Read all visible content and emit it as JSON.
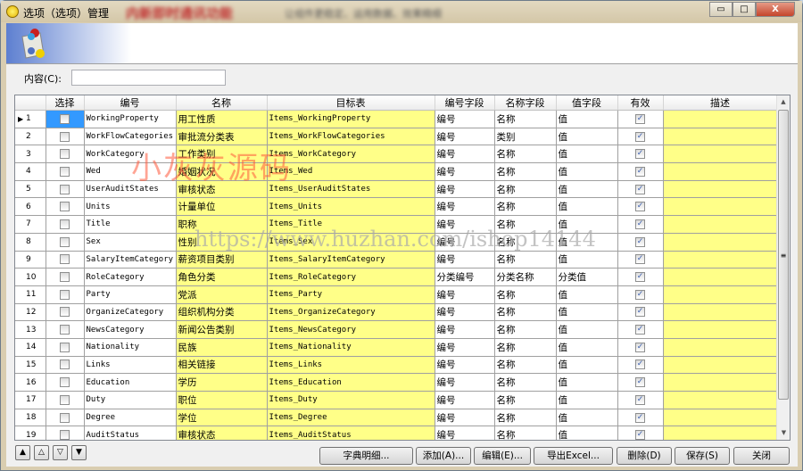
{
  "window": {
    "title": "选项（选项）管理",
    "blurred_title": "内新即时通讯功能",
    "blurred_sub": "让组件更稳定、运用数据、效果精细",
    "minimize": "▭",
    "maximize": "□",
    "close": "X"
  },
  "filter": {
    "label": "内容(C):",
    "value": ""
  },
  "grid": {
    "columns": [
      "选择",
      "编号",
      "名称",
      "目标表",
      "编号字段",
      "名称字段",
      "值字段",
      "有效",
      "描述"
    ],
    "rows": [
      {
        "n": "1",
        "selected": false,
        "code": "WorkingProperty",
        "name": "用工性质",
        "table": "Items_WorkingProperty",
        "codeField": "编号",
        "nameField": "名称",
        "valueField": "值",
        "valid": true,
        "desc": ""
      },
      {
        "n": "2",
        "selected": false,
        "code": "WorkFlowCategories",
        "name": "审批流分类表",
        "table": "Items_WorkFlowCategories",
        "codeField": "编号",
        "nameField": "类别",
        "valueField": "值",
        "valid": true,
        "desc": ""
      },
      {
        "n": "3",
        "selected": false,
        "code": "WorkCategory",
        "name": "工作类别",
        "table": "Items_WorkCategory",
        "codeField": "编号",
        "nameField": "名称",
        "valueField": "值",
        "valid": true,
        "desc": ""
      },
      {
        "n": "4",
        "selected": false,
        "code": "Wed",
        "name": "婚姻状况",
        "table": "Items_Wed",
        "codeField": "编号",
        "nameField": "名称",
        "valueField": "值",
        "valid": true,
        "desc": ""
      },
      {
        "n": "5",
        "selected": false,
        "code": "UserAuditStates",
        "name": "审核状态",
        "table": "Items_UserAuditStates",
        "codeField": "编号",
        "nameField": "名称",
        "valueField": "值",
        "valid": true,
        "desc": ""
      },
      {
        "n": "6",
        "selected": false,
        "code": "Units",
        "name": "计量单位",
        "table": "Items_Units",
        "codeField": "编号",
        "nameField": "名称",
        "valueField": "值",
        "valid": true,
        "desc": ""
      },
      {
        "n": "7",
        "selected": false,
        "code": "Title",
        "name": "职称",
        "table": "Items_Title",
        "codeField": "编号",
        "nameField": "名称",
        "valueField": "值",
        "valid": true,
        "desc": ""
      },
      {
        "n": "8",
        "selected": false,
        "code": "Sex",
        "name": "性别",
        "table": "Items_Sex",
        "codeField": "编号",
        "nameField": "名称",
        "valueField": "值",
        "valid": true,
        "desc": ""
      },
      {
        "n": "9",
        "selected": false,
        "code": "SalaryItemCategory",
        "name": "薪资项目类别",
        "table": "Items_SalaryItemCategory",
        "codeField": "编号",
        "nameField": "名称",
        "valueField": "值",
        "valid": true,
        "desc": ""
      },
      {
        "n": "10",
        "selected": false,
        "code": "RoleCategory",
        "name": "角色分类",
        "table": "Items_RoleCategory",
        "codeField": "分类编号",
        "nameField": "分类名称",
        "valueField": "分类值",
        "valid": true,
        "desc": ""
      },
      {
        "n": "11",
        "selected": false,
        "code": "Party",
        "name": "党派",
        "table": "Items_Party",
        "codeField": "编号",
        "nameField": "名称",
        "valueField": "值",
        "valid": true,
        "desc": ""
      },
      {
        "n": "12",
        "selected": false,
        "code": "OrganizeCategory",
        "name": "组织机构分类",
        "table": "Items_OrganizeCategory",
        "codeField": "编号",
        "nameField": "名称",
        "valueField": "值",
        "valid": true,
        "desc": ""
      },
      {
        "n": "13",
        "selected": false,
        "code": "NewsCategory",
        "name": "新闻公告类别",
        "table": "Items_NewsCategory",
        "codeField": "编号",
        "nameField": "名称",
        "valueField": "值",
        "valid": true,
        "desc": ""
      },
      {
        "n": "14",
        "selected": false,
        "code": "Nationality",
        "name": "民族",
        "table": "Items_Nationality",
        "codeField": "编号",
        "nameField": "名称",
        "valueField": "值",
        "valid": true,
        "desc": ""
      },
      {
        "n": "15",
        "selected": false,
        "code": "Links",
        "name": "相关链接",
        "table": "Items_Links",
        "codeField": "编号",
        "nameField": "名称",
        "valueField": "值",
        "valid": true,
        "desc": ""
      },
      {
        "n": "16",
        "selected": false,
        "code": "Education",
        "name": "学历",
        "table": "Items_Education",
        "codeField": "编号",
        "nameField": "名称",
        "valueField": "值",
        "valid": true,
        "desc": ""
      },
      {
        "n": "17",
        "selected": false,
        "code": "Duty",
        "name": "职位",
        "table": "Items_Duty",
        "codeField": "编号",
        "nameField": "名称",
        "valueField": "值",
        "valid": true,
        "desc": ""
      },
      {
        "n": "18",
        "selected": false,
        "code": "Degree",
        "name": "学位",
        "table": "Items_Degree",
        "codeField": "编号",
        "nameField": "名称",
        "valueField": "值",
        "valid": true,
        "desc": ""
      },
      {
        "n": "19",
        "selected": false,
        "code": "AuditStatus",
        "name": "审核状态",
        "table": "Items_AuditStatus",
        "codeField": "编号",
        "nameField": "名称",
        "valueField": "值",
        "valid": true,
        "desc": ""
      }
    ]
  },
  "nav_buttons": [
    "▲",
    "△",
    "▽",
    "▼"
  ],
  "buttons": {
    "dict": "字典明细...",
    "add": "添加(A)...",
    "edit": "编辑(E)...",
    "export": "导出Excel...",
    "delete": "删除(D)",
    "save": "保存(S)",
    "close": "关闭"
  },
  "watermarks": {
    "brand": "小灰灰源码",
    "url": "https://www.huzhan.com/ishop14144"
  },
  "colors": {
    "editable_cell": "#ffff88",
    "selection": "#3399ff"
  }
}
